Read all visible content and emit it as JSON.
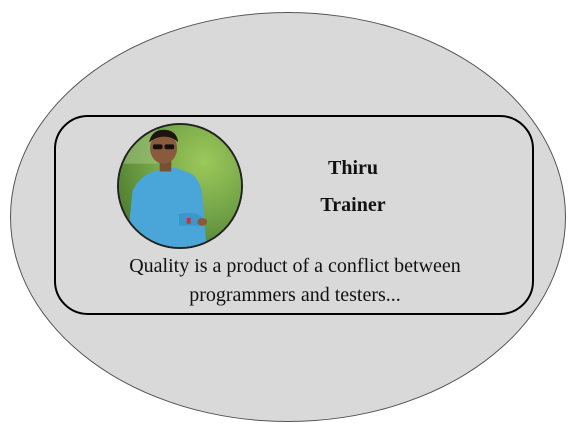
{
  "profile": {
    "name": "Thiru",
    "role": "Trainer",
    "quote_line1": "Quality is a product of a conflict between",
    "quote_line2": "programmers and testers..."
  },
  "colors": {
    "background_ellipse": "#d9d9d9",
    "card_border": "#000000",
    "photo_grass": "#6fa046",
    "shirt": "#4aa6d8"
  }
}
